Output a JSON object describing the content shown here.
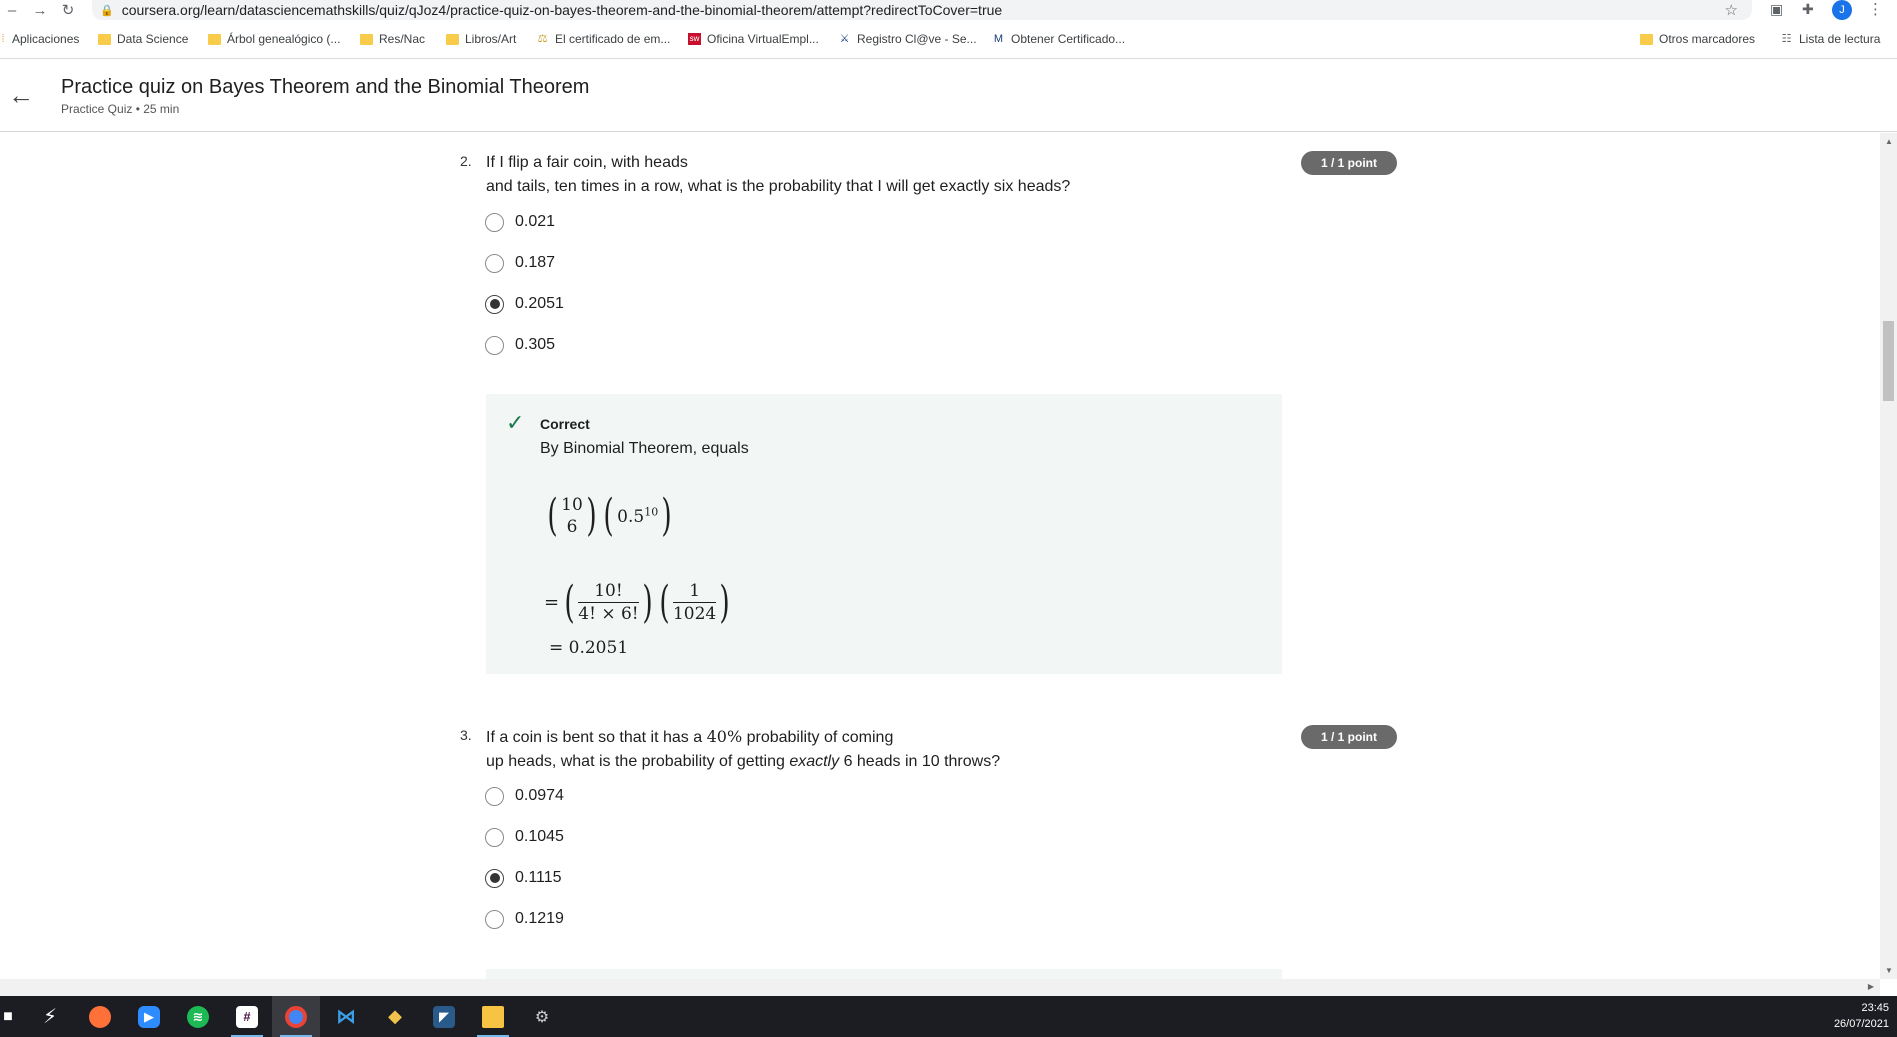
{
  "browser": {
    "url": "coursera.org/learn/datasciencemathskills/quiz/qJoz4/practice-quiz-on-bayes-theorem-and-the-binomial-theorem/attempt?redirectToCover=true",
    "avatar_letter": "J"
  },
  "bookmarks": {
    "items": [
      {
        "label": "Aplicaciones",
        "icon": "apps-grid-icon"
      },
      {
        "label": "Data Science",
        "icon": "folder-icon"
      },
      {
        "label": "Árbol genealógico (...",
        "icon": "folder-icon"
      },
      {
        "label": "Res/Nac",
        "icon": "folder-icon"
      },
      {
        "label": "Libros/Art",
        "icon": "folder-icon"
      },
      {
        "label": "El certificado de em...",
        "icon": "certificate-icon"
      },
      {
        "label": "Oficina VirtualEmpl...",
        "icon": "office-icon"
      },
      {
        "label": "Registro Cl@ve - Se...",
        "icon": "clave-icon"
      },
      {
        "label": "Obtener Certificado...",
        "icon": "fnmt-icon"
      }
    ],
    "other": "Otros marcadores",
    "reading_list": "Lista de lectura"
  },
  "header": {
    "title": "Practice quiz on Bayes Theorem and the Binomial Theorem",
    "subtitle": "Practice Quiz • 25 min"
  },
  "questions": [
    {
      "number": "2.",
      "text_line1": "If I flip a fair coin, with heads",
      "text_line2": "and tails, ten times in a row, what is the probability that I will get exactly six heads?",
      "points": "1 / 1 point",
      "options": [
        "0.021",
        "0.187",
        "0.2051",
        "0.305"
      ],
      "selected_index": 2,
      "feedback": {
        "label": "Correct",
        "text": "By Binomial Theorem, equals",
        "math": {
          "binom_top": "10",
          "binom_bottom": "6",
          "base": "0.5",
          "exponent": "10",
          "equals": "=",
          "frac1_num": "10!",
          "frac1_den": "4! × 6!",
          "frac2_num": "1",
          "frac2_den": "1024",
          "result": "= 0.2051"
        }
      }
    },
    {
      "number": "3.",
      "text_line1_a": "If a coin is bent so that it has a",
      "text_line1_math": "40%",
      "text_line1_b": "probability of coming",
      "text_line2_a": "up heads, what is the probability of getting",
      "text_line2_em": "exactly",
      "text_line2_b": "6 heads in 10 throws?",
      "points": "1 / 1 point",
      "options": [
        "0.0974",
        "0.1045",
        "0.1115",
        "0.1219"
      ],
      "selected_index": 2
    }
  ],
  "taskbar": {
    "time": "23:45",
    "date": "26/07/2021",
    "apps": [
      "windows-start-icon",
      "lightning-app-icon",
      "firefox-icon",
      "zoom-icon",
      "spotify-icon",
      "slack-icon",
      "chrome-icon",
      "vscode-icon",
      "git-icon",
      "mysql-workbench-icon",
      "file-explorer-icon",
      "app-icon"
    ]
  },
  "colors": {
    "badge": "#6a6a6a",
    "feedback_bg": "#f2f7f5",
    "check": "#1f7a4d",
    "taskbar": "#1c1d22"
  }
}
